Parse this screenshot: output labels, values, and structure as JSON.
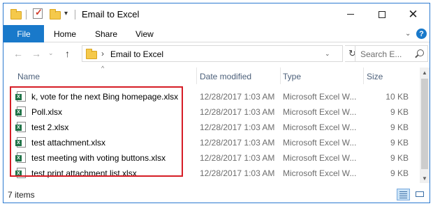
{
  "window": {
    "title": "Email to Excel",
    "controls": {
      "minimize": "minimize",
      "maximize": "maximize",
      "close": "✕"
    }
  },
  "ribbon": {
    "tabs": [
      "File",
      "Home",
      "Share",
      "View"
    ],
    "help": "?"
  },
  "address": {
    "path": "Email to Excel",
    "search_placeholder": "Search E..."
  },
  "columns": {
    "name": "Name",
    "date": "Date modified",
    "type": "Type",
    "size": "Size"
  },
  "files": [
    {
      "name": "k, vote for the next Bing homepage.xlsx",
      "date": "12/28/2017 1:03 AM",
      "type": "Microsoft Excel W...",
      "size": "10 KB"
    },
    {
      "name": "Poll.xlsx",
      "date": "12/28/2017 1:03 AM",
      "type": "Microsoft Excel W...",
      "size": "9 KB"
    },
    {
      "name": "test 2.xlsx",
      "date": "12/28/2017 1:03 AM",
      "type": "Microsoft Excel W...",
      "size": "9 KB"
    },
    {
      "name": "test attachment.xlsx",
      "date": "12/28/2017 1:03 AM",
      "type": "Microsoft Excel W...",
      "size": "9 KB"
    },
    {
      "name": "test meeting with voting buttons.xlsx",
      "date": "12/28/2017 1:03 AM",
      "type": "Microsoft Excel W...",
      "size": "9 KB"
    },
    {
      "name": "test print attachment list.xlsx",
      "date": "12/28/2017 1:03 AM",
      "type": "Microsoft Excel W...",
      "size": "9 KB"
    }
  ],
  "status": {
    "item_count": "7 items"
  },
  "icons": {
    "file": "excel-file-icon",
    "folder": "folder-icon"
  },
  "colors": {
    "accent": "#1979ca",
    "highlight": "#d61c25",
    "excel": "#1e7145"
  }
}
